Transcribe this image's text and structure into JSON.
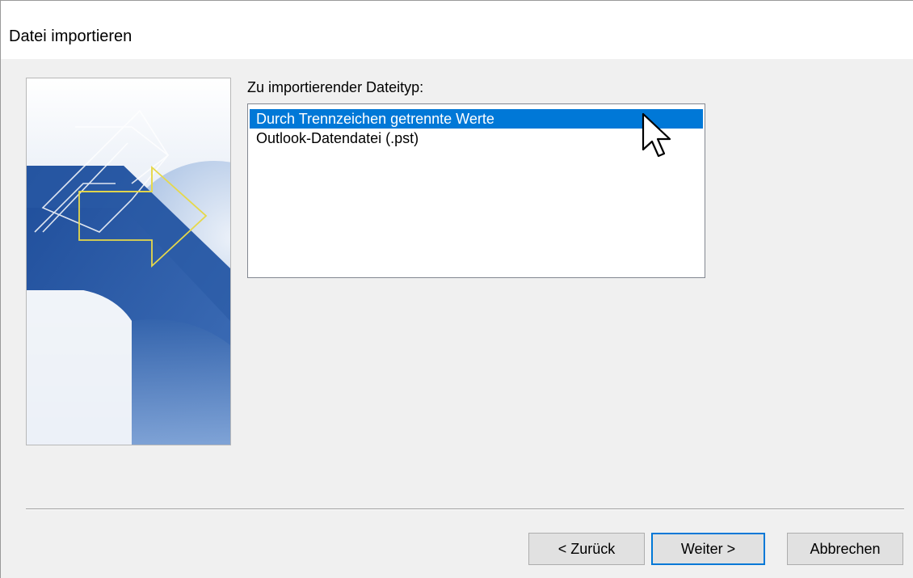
{
  "window": {
    "title": "Datei importieren"
  },
  "banner": {
    "icon": "import-arrows-illustration",
    "colors": {
      "dark_blue": "#2a5aa5",
      "mid_blue": "#4b7bc4",
      "light_blue": "#8fb0de",
      "arrow_outline": "#e6d84a"
    }
  },
  "file_type": {
    "label": "Zu importierender Dateityp:",
    "items": [
      {
        "label": "Durch Trennzeichen getrennte Werte",
        "selected": true
      },
      {
        "label": "Outlook-Datendatei (.pst)",
        "selected": false
      }
    ],
    "selection_color": "#0078d7"
  },
  "buttons": {
    "back_label": "< Zurück",
    "next_label": "Weiter >",
    "cancel_label": "Abbrechen"
  },
  "cursor": {
    "icon": "mouse-pointer-icon"
  }
}
